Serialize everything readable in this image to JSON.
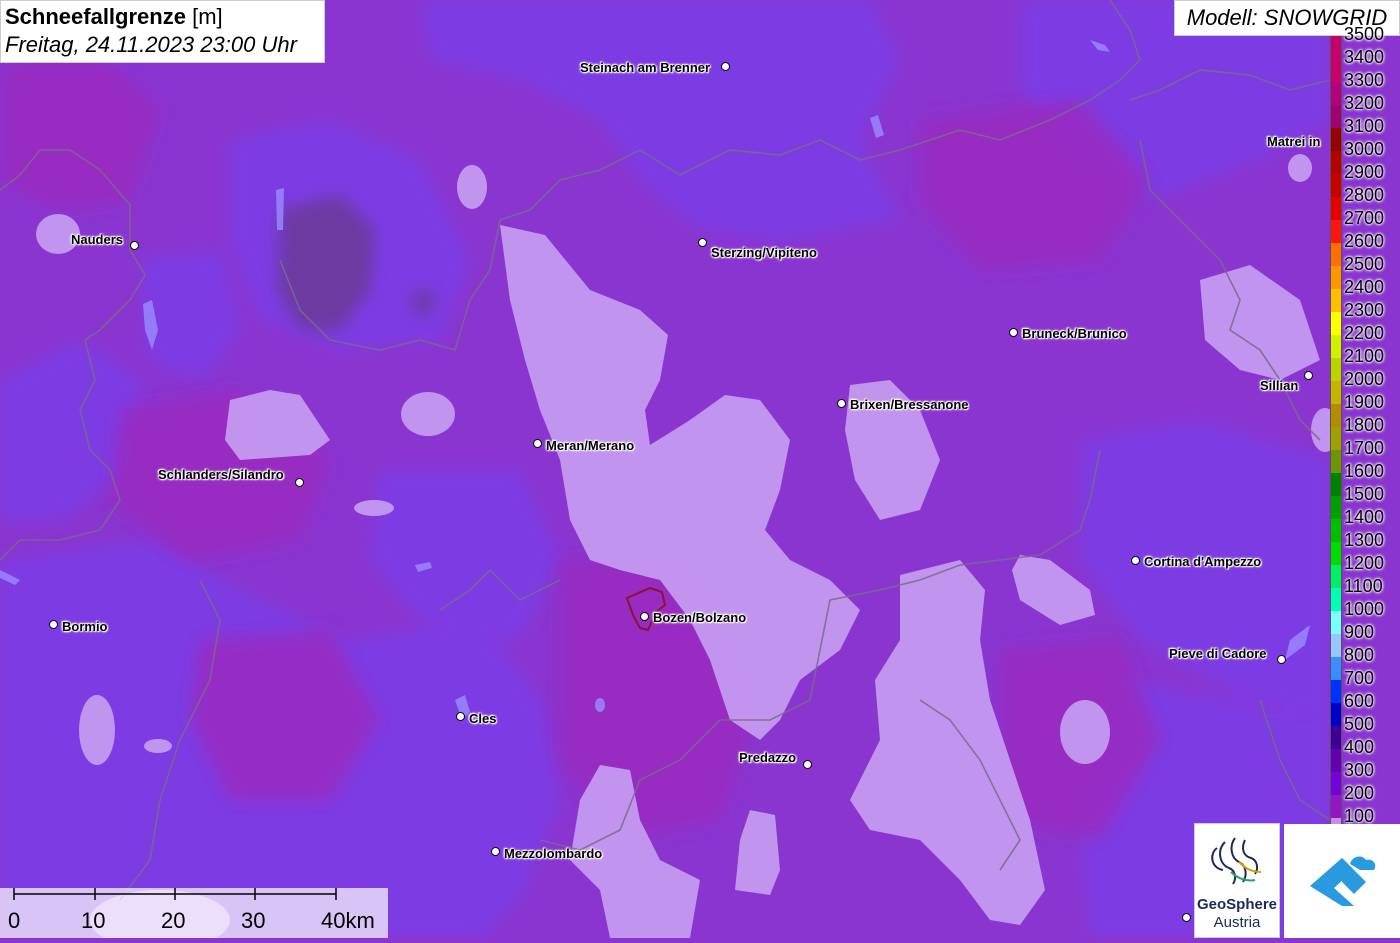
{
  "header": {
    "title_bold": "Schneefallgrenze",
    "title_unit": "[m]",
    "subtitle": "Freitag, 24.11.2023 23:00 Uhr"
  },
  "model": {
    "label": "Modell: SNOWGRID"
  },
  "legend": {
    "items": [
      {
        "label": "3500",
        "color": "#c8006e"
      },
      {
        "label": "3400",
        "color": "#c8006e"
      },
      {
        "label": "3300",
        "color": "#b4007a"
      },
      {
        "label": "3200",
        "color": "#a00078"
      },
      {
        "label": "3100",
        "color": "#960000"
      },
      {
        "label": "3000",
        "color": "#b40000"
      },
      {
        "label": "2900",
        "color": "#c80000"
      },
      {
        "label": "2800",
        "color": "#e60000"
      },
      {
        "label": "2700",
        "color": "#ff1414"
      },
      {
        "label": "2600",
        "color": "#ff6e00"
      },
      {
        "label": "2500",
        "color": "#ff9600"
      },
      {
        "label": "2400",
        "color": "#ffbe00"
      },
      {
        "label": "2300",
        "color": "#ffff00"
      },
      {
        "label": "2200",
        "color": "#d2f000"
      },
      {
        "label": "2100",
        "color": "#bed200"
      },
      {
        "label": "2000",
        "color": "#c8b400"
      },
      {
        "label": "1900",
        "color": "#b48c00"
      },
      {
        "label": "1800",
        "color": "#a0a000"
      },
      {
        "label": "1700",
        "color": "#6e9600"
      },
      {
        "label": "1600",
        "color": "#008200"
      },
      {
        "label": "1500",
        "color": "#00a000"
      },
      {
        "label": "1400",
        "color": "#00be00"
      },
      {
        "label": "1300",
        "color": "#00dc00"
      },
      {
        "label": "1200",
        "color": "#00f064"
      },
      {
        "label": "1100",
        "color": "#00ffb4"
      },
      {
        "label": "1000",
        "color": "#78ffff"
      },
      {
        "label": "900",
        "color": "#96c8ff"
      },
      {
        "label": "800",
        "color": "#3c8cff"
      },
      {
        "label": "700",
        "color": "#0032ff"
      },
      {
        "label": "600",
        "color": "#0000c8"
      },
      {
        "label": "500",
        "color": "#3c0096"
      },
      {
        "label": "400",
        "color": "#6400b4"
      },
      {
        "label": "300",
        "color": "#7800dc"
      },
      {
        "label": "200",
        "color": "#9614c8"
      },
      {
        "label": "100",
        "color": "#c88cf0"
      }
    ]
  },
  "cities": [
    {
      "name": "Steinach am Brenner"
    },
    {
      "name": "Nauders"
    },
    {
      "name": "Sterzing/Vipiteno"
    },
    {
      "name": "Matrei in"
    },
    {
      "name": "Bruneck/Brunico"
    },
    {
      "name": "Sillian"
    },
    {
      "name": "Brixen/Bressanone"
    },
    {
      "name": "Meran/Merano"
    },
    {
      "name": "Schlanders/Silandro"
    },
    {
      "name": "Cortina d'Ampezzo"
    },
    {
      "name": "Bozen/Bolzano"
    },
    {
      "name": "Bormio"
    },
    {
      "name": "Pieve di Cadore"
    },
    {
      "name": "Cles"
    },
    {
      "name": "Predazzo"
    },
    {
      "name": "Mezzolombardo"
    }
  ],
  "scale": {
    "ticks": [
      "0",
      "10",
      "20",
      "30",
      "40km"
    ]
  },
  "logos": {
    "geo_line1": "GeoSphere",
    "geo_line2": "Austria"
  },
  "colors": {
    "base_purple": "#8a35d0",
    "light_lilac": "#c49af0",
    "dark_violet": "#6a2ea0",
    "blue_violet": "#7a3ce8"
  }
}
